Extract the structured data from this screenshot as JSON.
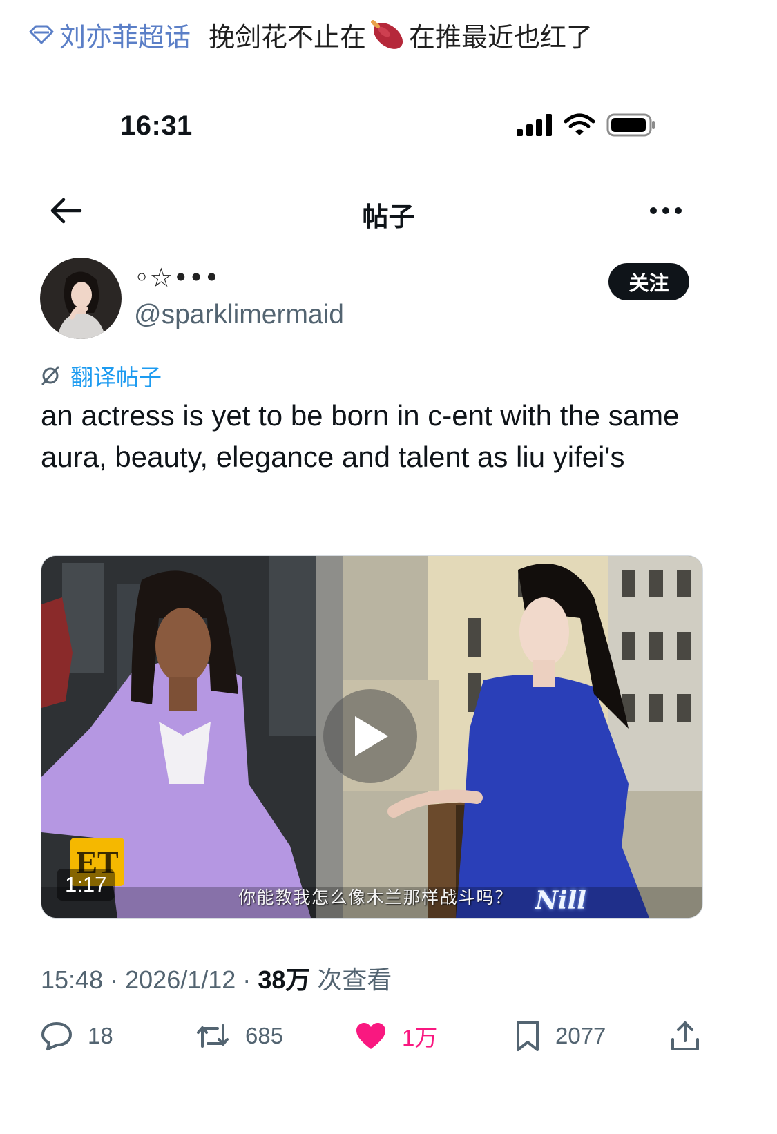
{
  "header": {
    "topic_tag": "刘亦菲超话",
    "headline_part1": "挽剑花不止在",
    "headline_part2": "在推最近也红了"
  },
  "status_bar": {
    "time": "16:31"
  },
  "nav": {
    "title": "帖子"
  },
  "author": {
    "display_name": "◦☆•••",
    "handle": "@sparklimermaid",
    "follow_label": "关注"
  },
  "post": {
    "translate_label": "翻译帖子",
    "text": "an actress is yet to be born in c-ent with the same aura, beauty, elegance and talent as liu yifei's"
  },
  "video": {
    "duration": "1:17",
    "subtitle": "你能教我怎么像木兰那样战斗吗？",
    "logo_text": "ET",
    "watermark": "Nill"
  },
  "meta": {
    "time": "15:48",
    "separator": "·",
    "date": "2026/1/12",
    "views_count": "38万",
    "views_label": "次查看"
  },
  "actions": {
    "replies": "18",
    "reposts": "685",
    "likes": "1万",
    "bookmarks": "2077"
  },
  "colors": {
    "accent_blue": "#1d9bf0",
    "like_pink": "#f91880",
    "topic_blue": "#5b7fc7",
    "text_primary": "#0f1419",
    "text_secondary": "#536471"
  }
}
